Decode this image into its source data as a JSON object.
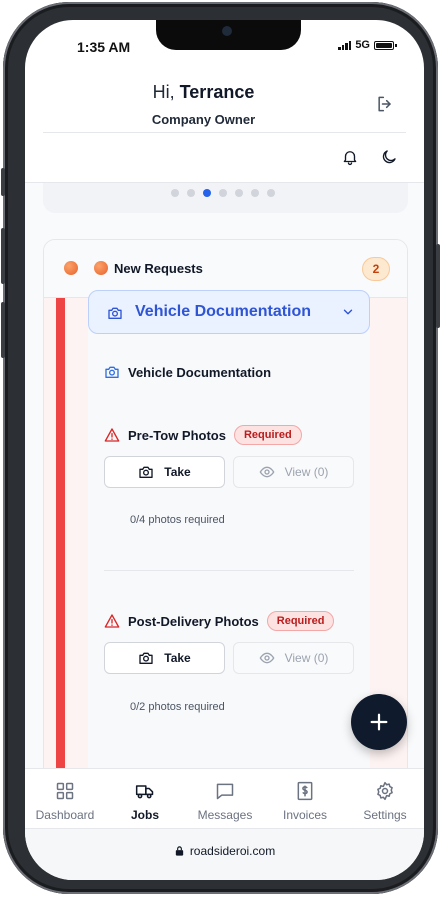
{
  "status": {
    "time": "1:35 AM",
    "network": "5G"
  },
  "header": {
    "greeting_prefix": "Hi, ",
    "user_name": "Terrance",
    "role": "Company Owner"
  },
  "carousel": {
    "count": 7,
    "active_index": 2
  },
  "requests": {
    "title": "New Requests",
    "count": "2",
    "section_title": "Vehicle Documentation",
    "subsection_title": "Vehicle Documentation",
    "groups": [
      {
        "title": "Pre-Tow Photos",
        "badge": "Required",
        "take_label": "Take",
        "view_label": "View (0)",
        "hint": "0/4 photos required"
      },
      {
        "title": "Post-Delivery Photos",
        "badge": "Required",
        "take_label": "Take",
        "view_label": "View (0)",
        "hint": "0/2 photos required"
      }
    ]
  },
  "fab": {
    "icon": "plus-icon"
  },
  "tabbar": {
    "items": [
      {
        "label": "Dashboard",
        "icon": "grid-icon",
        "active": false
      },
      {
        "label": "Jobs",
        "icon": "truck-icon",
        "active": true
      },
      {
        "label": "Messages",
        "icon": "message-icon",
        "active": false
      },
      {
        "label": "Invoices",
        "icon": "invoice-icon",
        "active": false
      },
      {
        "label": "Settings",
        "icon": "gear-icon",
        "active": false
      }
    ]
  },
  "browser": {
    "url": "roadsideroi.com"
  },
  "colors": {
    "accent": "#2563eb",
    "danger": "#ef4444",
    "fab": "#0f1b2d",
    "badge_orange": "#c2410c"
  }
}
